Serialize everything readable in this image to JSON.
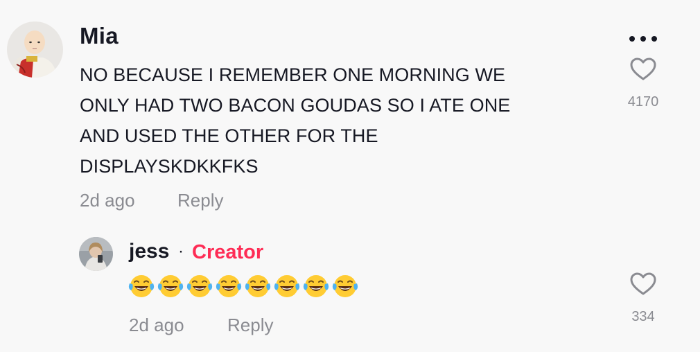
{
  "comment": {
    "username": "Mia",
    "text_lines": [
      "NO BECAUSE I REMEMBER ONE MORNING WE",
      "ONLY HAD TWO BACON GOUDAS SO I ATE ONE",
      "AND USED THE OTHER FOR THE",
      "DISPLAYSKDKKFKS"
    ],
    "time": "2d ago",
    "reply_label": "Reply",
    "like_count": "4170",
    "more_icon": "more-horizontal-icon",
    "like_icon": "heart-outline-icon"
  },
  "reply": {
    "username": "jess",
    "separator": "·",
    "badge": "Creator",
    "emoji": "😂😂😂😂😂😂😂😂",
    "emoji_count": 8,
    "time": "2d ago",
    "reply_label": "Reply",
    "like_count": "334",
    "like_icon": "heart-outline-icon"
  },
  "colors": {
    "background": "#f8f8f8",
    "text_primary": "#161823",
    "text_secondary": "#8a8b91",
    "creator_accent": "#fe2c55"
  }
}
